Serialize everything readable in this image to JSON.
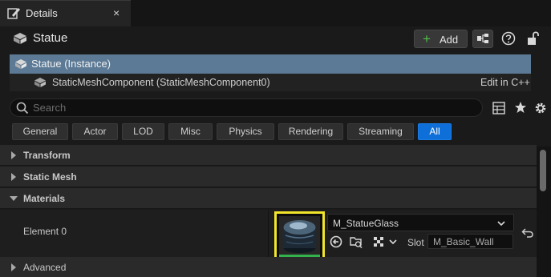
{
  "tab": {
    "title": "Details",
    "icon": "pencil-icon",
    "close": "×"
  },
  "header": {
    "title": "Statue",
    "add_label": "Add"
  },
  "tree": {
    "rows": [
      {
        "label": "Statue (Instance)",
        "selected": true
      },
      {
        "label": "StaticMeshComponent (StaticMeshComponent0)",
        "action": "Edit in C++"
      }
    ]
  },
  "search": {
    "placeholder": "Search",
    "value": ""
  },
  "categories": [
    {
      "label": "General"
    },
    {
      "label": "Actor"
    },
    {
      "label": "LOD"
    },
    {
      "label": "Misc"
    },
    {
      "label": "Physics"
    },
    {
      "label": "Rendering"
    },
    {
      "label": "Streaming"
    },
    {
      "label": "All",
      "active": true
    }
  ],
  "sections": [
    {
      "label": "Transform",
      "expanded": false
    },
    {
      "label": "Static Mesh",
      "expanded": false
    },
    {
      "label": "Materials",
      "expanded": true
    },
    {
      "label": "Advanced",
      "expanded": false
    }
  ],
  "materials": {
    "element_label": "Element 0",
    "material": "M_StatueGlass",
    "slot_label": "Slot",
    "slot_value": "M_Basic_Wall"
  },
  "colors": {
    "accent": "#0f6fd8",
    "selection": "#5c7a96",
    "highlight": "#f2e52a",
    "add_plus": "#4fbf4a"
  }
}
